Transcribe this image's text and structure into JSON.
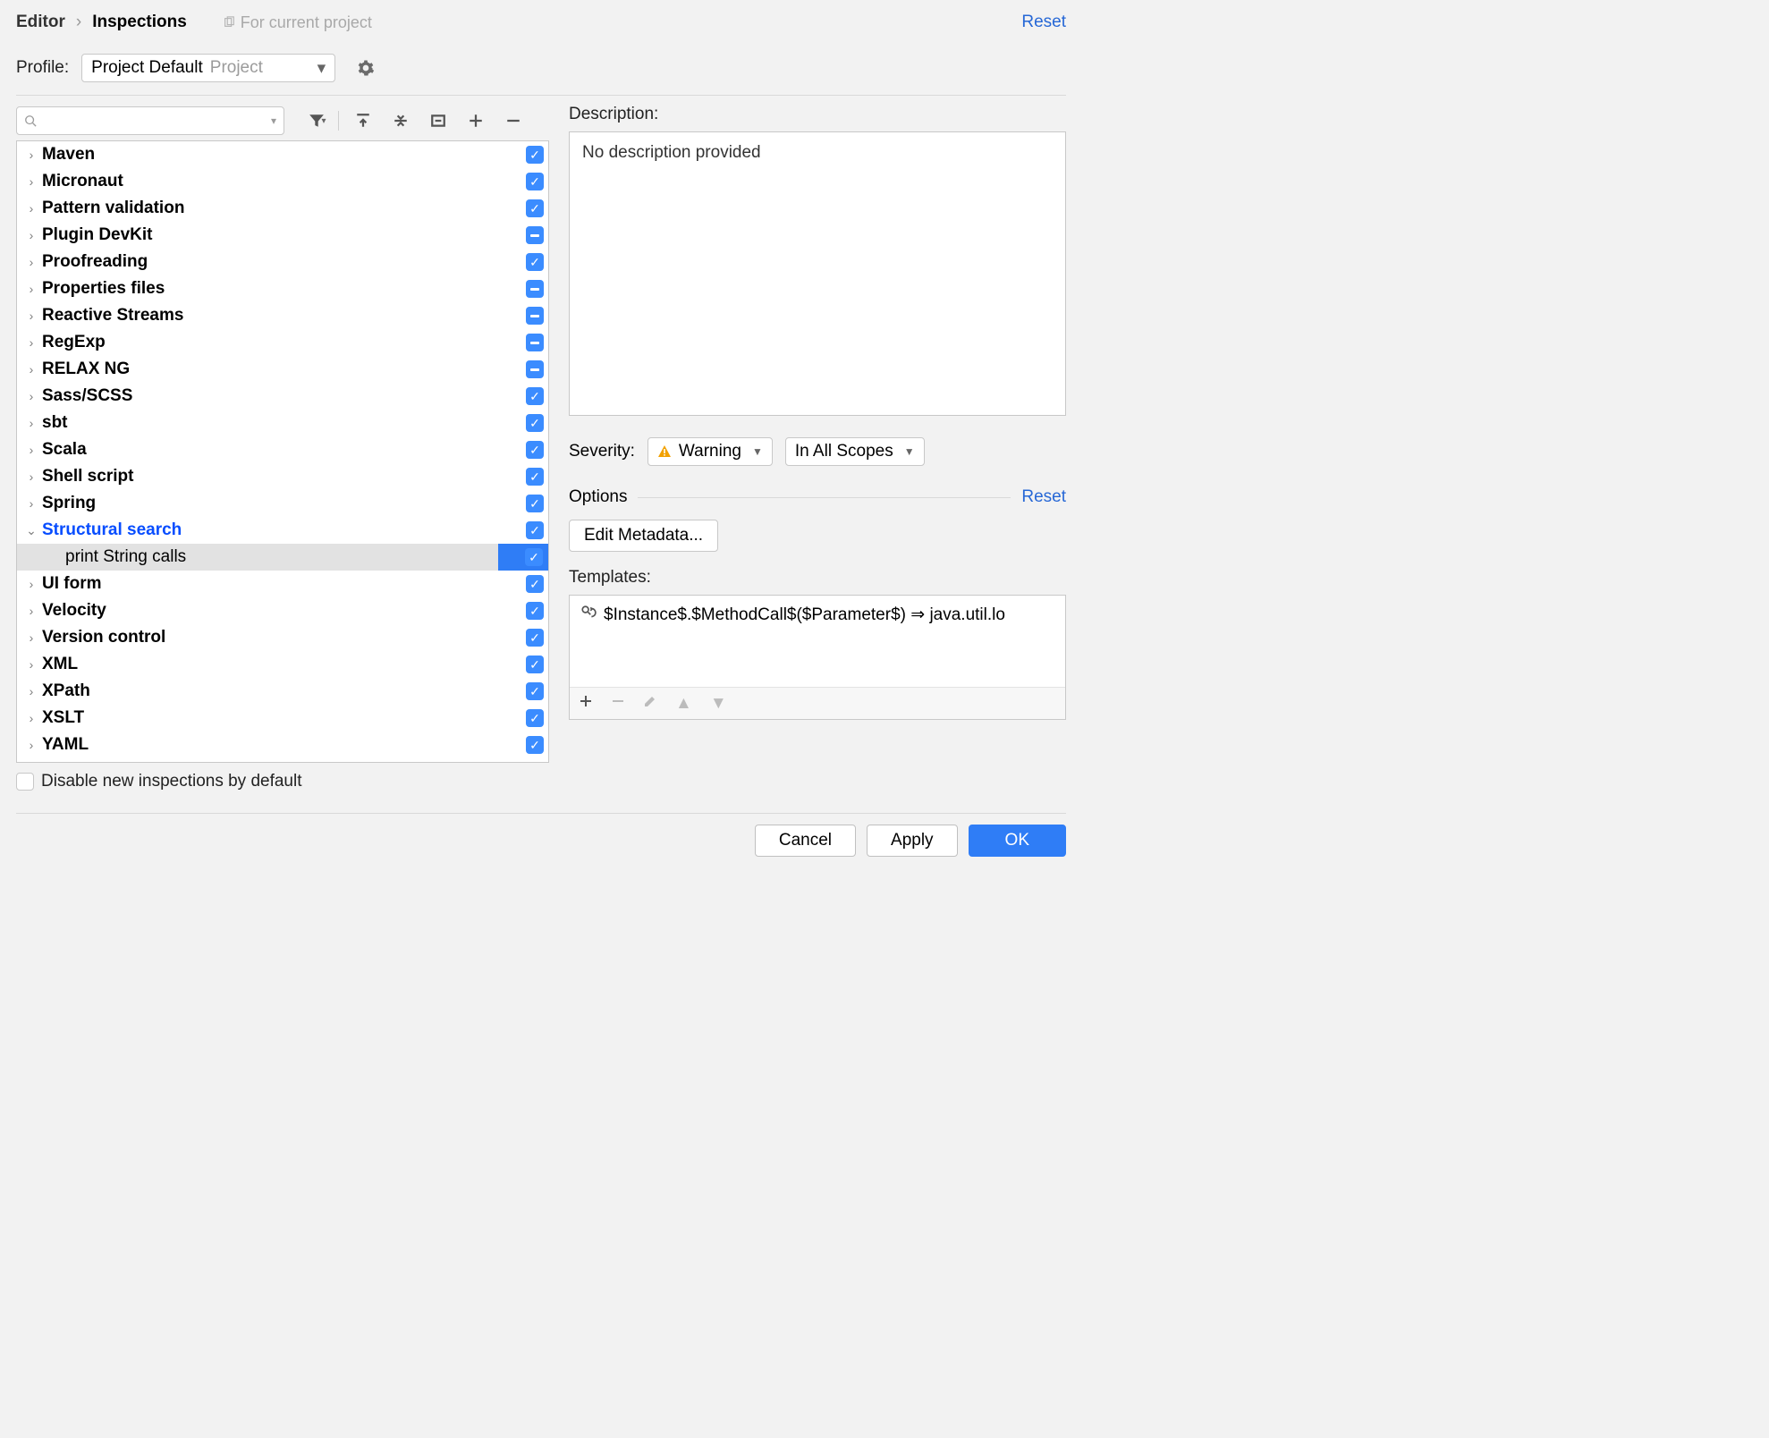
{
  "header": {
    "crumb_editor": "Editor",
    "crumb_inspections": "Inspections",
    "scope_note": "For current project",
    "reset": "Reset"
  },
  "profile": {
    "label": "Profile:",
    "name": "Project Default",
    "scope": "Project"
  },
  "search": {
    "placeholder": ""
  },
  "tree": {
    "items": [
      {
        "label": "Maven",
        "state": "checked"
      },
      {
        "label": "Micronaut",
        "state": "checked"
      },
      {
        "label": "Pattern validation",
        "state": "checked"
      },
      {
        "label": "Plugin DevKit",
        "state": "indet"
      },
      {
        "label": "Proofreading",
        "state": "checked"
      },
      {
        "label": "Properties files",
        "state": "indet"
      },
      {
        "label": "Reactive Streams",
        "state": "indet"
      },
      {
        "label": "RegExp",
        "state": "indet"
      },
      {
        "label": "RELAX NG",
        "state": "indet"
      },
      {
        "label": "Sass/SCSS",
        "state": "checked"
      },
      {
        "label": "sbt",
        "state": "checked"
      },
      {
        "label": "Scala",
        "state": "checked"
      },
      {
        "label": "Shell script",
        "state": "checked"
      },
      {
        "label": "Spring",
        "state": "checked"
      },
      {
        "label": "Structural search",
        "state": "checked",
        "expanded": true,
        "highlight": true
      },
      {
        "label": "print String calls",
        "state": "checked",
        "child": true,
        "selected": true,
        "warn": true
      },
      {
        "label": "UI form",
        "state": "checked"
      },
      {
        "label": "Velocity",
        "state": "checked"
      },
      {
        "label": "Version control",
        "state": "checked"
      },
      {
        "label": "XML",
        "state": "checked"
      },
      {
        "label": "XPath",
        "state": "checked"
      },
      {
        "label": "XSLT",
        "state": "checked"
      },
      {
        "label": "YAML",
        "state": "checked"
      }
    ],
    "disable_label": "Disable new inspections by default"
  },
  "right": {
    "description_label": "Description:",
    "description_text": "No description provided",
    "severity_label": "Severity:",
    "severity_value": "Warning",
    "scope_value": "In All Scopes",
    "options_label": "Options",
    "options_reset": "Reset",
    "edit_metadata": "Edit Metadata...",
    "templates_label": "Templates:",
    "template_item": "$Instance$.$MethodCall$($Parameter$) ⇒ java.util.lo"
  },
  "footer": {
    "cancel": "Cancel",
    "apply": "Apply",
    "ok": "OK"
  }
}
